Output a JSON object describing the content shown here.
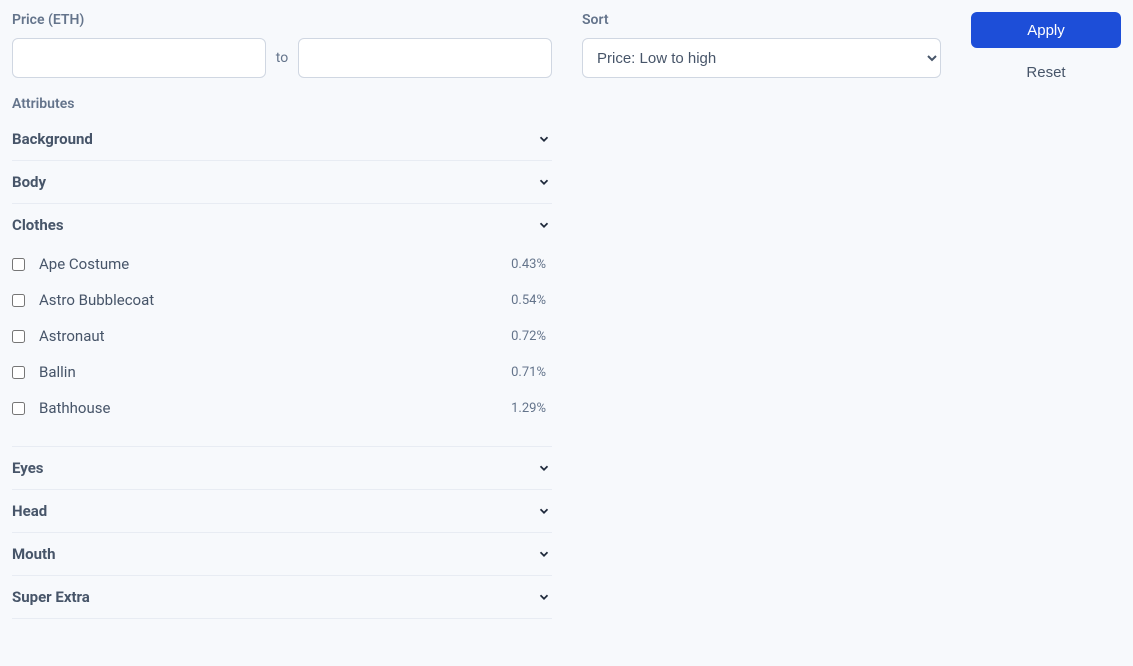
{
  "price": {
    "label": "Price (ETH)",
    "to": "to",
    "min": "",
    "max": ""
  },
  "sort": {
    "label": "Sort",
    "selected": "Price: Low to high"
  },
  "actions": {
    "apply": "Apply",
    "reset": "Reset"
  },
  "attributes": {
    "label": "Attributes",
    "sections": [
      {
        "title": "Background",
        "expanded": false
      },
      {
        "title": "Body",
        "expanded": false
      },
      {
        "title": "Clothes",
        "expanded": true
      },
      {
        "title": "Eyes",
        "expanded": false
      },
      {
        "title": "Head",
        "expanded": false
      },
      {
        "title": "Mouth",
        "expanded": false
      },
      {
        "title": "Super Extra",
        "expanded": false
      }
    ]
  },
  "clothes_options": [
    {
      "label": "Ape Costume",
      "pct": "0.43%"
    },
    {
      "label": "Astro Bubblecoat",
      "pct": "0.54%"
    },
    {
      "label": "Astronaut",
      "pct": "0.72%"
    },
    {
      "label": "Ballin",
      "pct": "0.71%"
    },
    {
      "label": "Bathhouse",
      "pct": "1.29%"
    }
  ]
}
